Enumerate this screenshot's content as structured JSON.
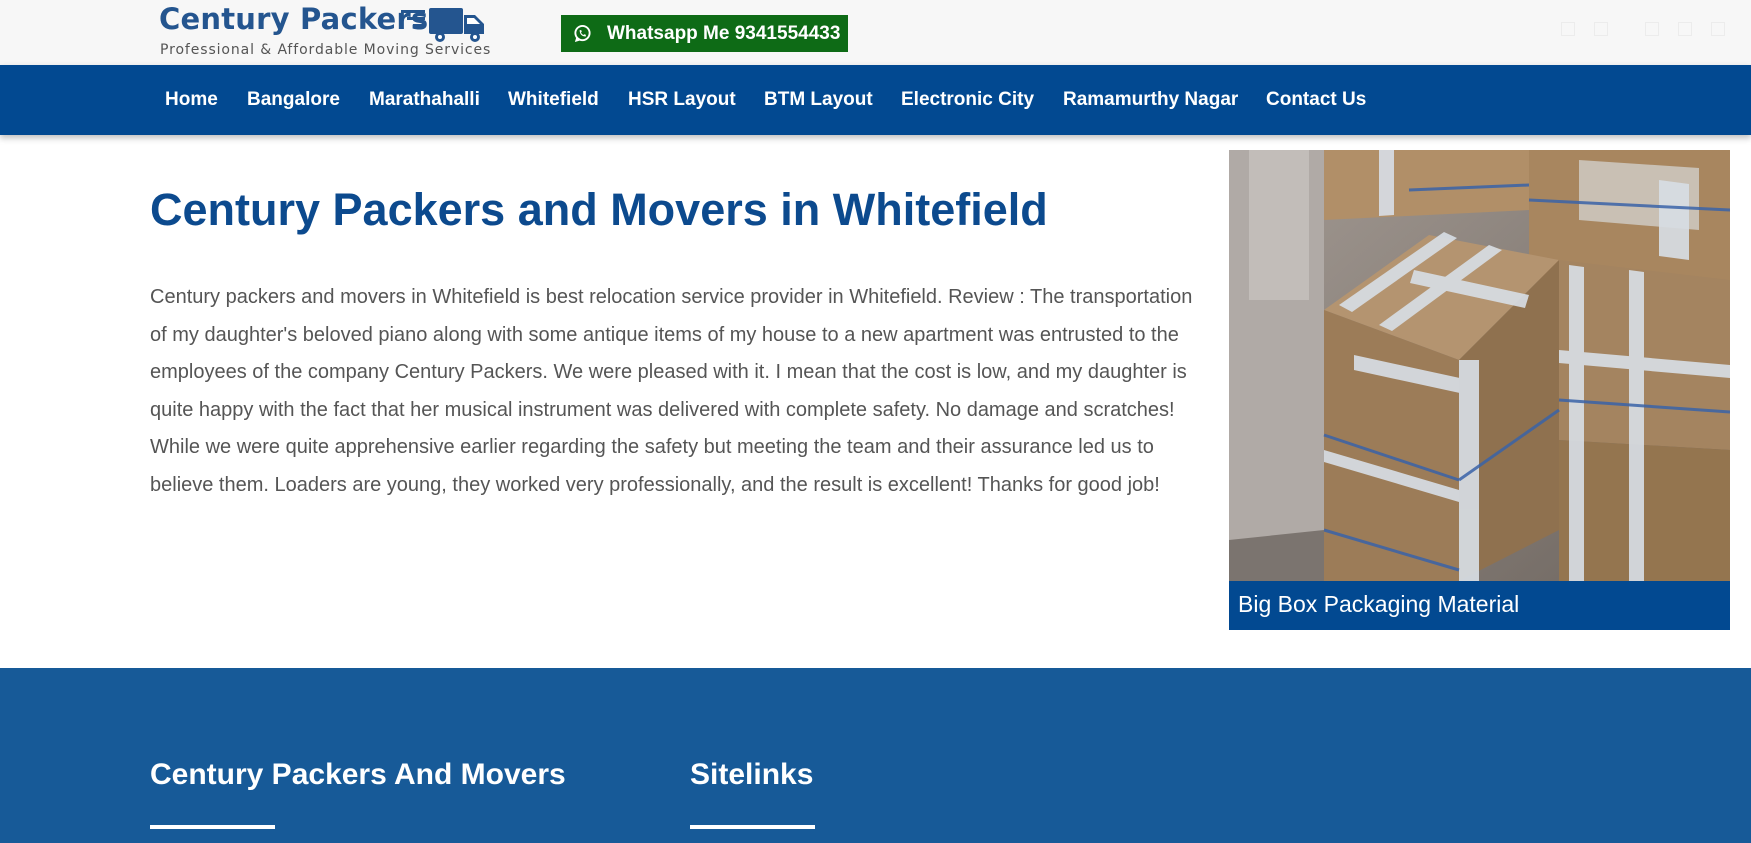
{
  "header": {
    "logo_title": "Century Packers",
    "logo_subtitle": "Professional & Affordable Moving Services",
    "whatsapp_label": "Whatsapp Me 9341554433"
  },
  "nav": {
    "items": [
      {
        "label": "Home"
      },
      {
        "label": "Bangalore"
      },
      {
        "label": "Marathahalli"
      },
      {
        "label": "Whitefield"
      },
      {
        "label": "HSR Layout"
      },
      {
        "label": "BTM Layout"
      },
      {
        "label": "Electronic City"
      },
      {
        "label": "Ramamurthy Nagar"
      },
      {
        "label": "Contact Us"
      }
    ]
  },
  "main": {
    "title": "Century Packers and Movers in Whitefield",
    "body": "Century packers and movers in Whitefield is best relocation service provider in Whitefield. Review : The transportation of my daughter's beloved piano along with some antique items of my house to a new apartment was entrusted to the employees of the company Century Packers. We were pleased with it. I mean that the cost is low, and my daughter is quite happy with the fact that her musical instrument was delivered with complete safety. No damage and scratches! While we were quite apprehensive earlier regarding the safety but meeting the team and their assurance led us to believe them. Loaders are young, they worked very professionally, and the result is excellent! Thanks for good job!"
  },
  "figure": {
    "caption": "Big Box Packaging Material"
  },
  "footer": {
    "col1_heading": "Century Packers And Movers",
    "col2_heading": "Sitelinks"
  },
  "colors": {
    "nav_bg": "#024991",
    "footer_bg": "#175a98",
    "title": "#0c4a8e",
    "whatsapp_bg": "#0e6b16"
  },
  "icons": [
    "truck-icon",
    "whatsapp-icon",
    "facebook-icon",
    "twitter-icon",
    "linkedin-icon",
    "instagram-icon",
    "youtube-icon"
  ]
}
